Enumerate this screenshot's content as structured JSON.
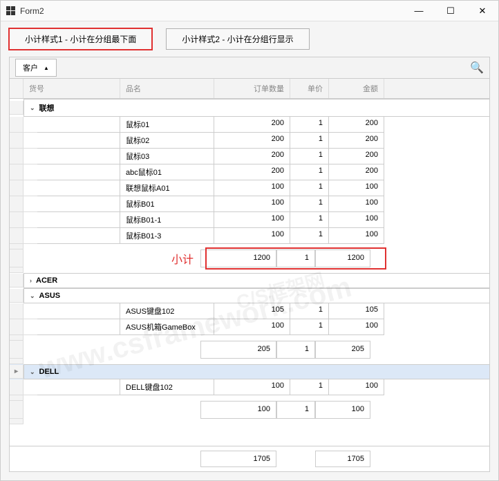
{
  "window": {
    "title": "Form2"
  },
  "toolbar": {
    "btn1": "小计样式1 - 小计在分组最下面",
    "btn2": "小计样式2 - 小计在分组行显示"
  },
  "groupBox": {
    "label": "客户"
  },
  "columns": {
    "c1": "货号",
    "c2": "品名",
    "c3": "订单数量",
    "c4": "单价",
    "c5": "金额"
  },
  "groups": [
    {
      "name": "联想",
      "expanded": true,
      "selected": false,
      "rows": [
        {
          "c2": "鼠标01",
          "c3": "200",
          "c4": "1",
          "c5": "200"
        },
        {
          "c2": "鼠标02",
          "c3": "200",
          "c4": "1",
          "c5": "200"
        },
        {
          "c2": "鼠标03",
          "c3": "200",
          "c4": "1",
          "c5": "200"
        },
        {
          "c2": "abc鼠标01",
          "c3": "200",
          "c4": "1",
          "c5": "200"
        },
        {
          "c2": "联想鼠标A01",
          "c3": "100",
          "c4": "1",
          "c5": "100"
        },
        {
          "c2": "鼠标B01",
          "c3": "100",
          "c4": "1",
          "c5": "100"
        },
        {
          "c2": "鼠标B01-1",
          "c3": "100",
          "c4": "1",
          "c5": "100"
        },
        {
          "c2": "鼠标B01-3",
          "c3": "100",
          "c4": "1",
          "c5": "100"
        }
      ],
      "subtotal": {
        "label": "小计",
        "c3": "1200",
        "c4": "1",
        "c5": "1200",
        "highlighted": true
      }
    },
    {
      "name": "ACER",
      "expanded": false,
      "selected": false,
      "rows": [],
      "subtotal": null
    },
    {
      "name": "ASUS",
      "expanded": true,
      "selected": false,
      "rows": [
        {
          "c2": "ASUS键盘102",
          "c3": "105",
          "c4": "1",
          "c5": "105"
        },
        {
          "c2": "ASUS机箱GameBox",
          "c3": "100",
          "c4": "1",
          "c5": "100"
        }
      ],
      "subtotal": {
        "label": "",
        "c3": "205",
        "c4": "1",
        "c5": "205",
        "highlighted": false
      }
    },
    {
      "name": "DELL",
      "expanded": true,
      "selected": true,
      "rows": [
        {
          "c2": "DELL键盘102",
          "c3": "100",
          "c4": "1",
          "c5": "100"
        }
      ],
      "subtotal": {
        "label": "",
        "c3": "100",
        "c4": "1",
        "c5": "100",
        "highlighted": false
      }
    }
  ],
  "grand": {
    "c3": "1705",
    "c5": "1705"
  },
  "watermarks": [
    "www.csframework.com",
    "C/S框架网"
  ]
}
